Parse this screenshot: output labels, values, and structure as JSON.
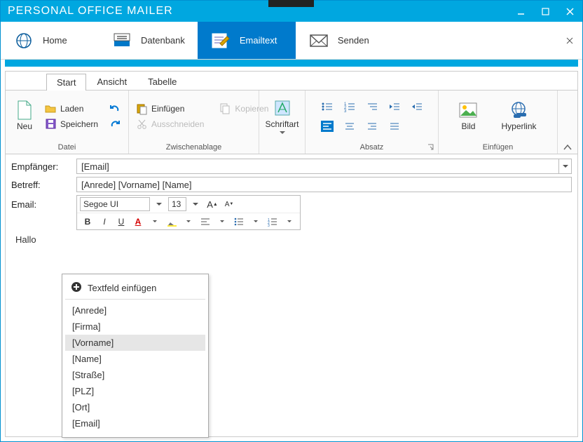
{
  "window": {
    "title": "PERSONAL OFFICE MAILER"
  },
  "nav": {
    "home": "Home",
    "datenbank": "Datenbank",
    "emailtext": "Emailtext",
    "senden": "Senden"
  },
  "tabs": {
    "start": "Start",
    "ansicht": "Ansicht",
    "tabelle": "Tabelle"
  },
  "ribbon": {
    "neu": "Neu",
    "laden": "Laden",
    "speichern": "Speichern",
    "datei": "Datei",
    "einfuegen": "Einfügen",
    "kopieren": "Kopieren",
    "ausschneiden": "Ausschneiden",
    "zwischenablage": "Zwischenablage",
    "schriftart": "Schriftart",
    "absatz": "Absatz",
    "bild": "Bild",
    "hyperlink": "Hyperlink",
    "einfuegen_grp": "Einfügen"
  },
  "fields": {
    "empfaenger_label": "Empfänger:",
    "empfaenger_value": "[Email]",
    "betreff_label": "Betreff:",
    "betreff_value": "[Anrede] [Vorname] [Name]",
    "email_label": "Email:"
  },
  "toolbar": {
    "font_name": "Segoe UI",
    "font_size": "13"
  },
  "editor": {
    "body_text": "Hallo"
  },
  "context": {
    "title": "Textfeld einfügen",
    "items": [
      "[Anrede]",
      "[Firma]",
      "[Vorname]",
      "[Name]",
      "[Straße]",
      "[PLZ]",
      "[Ort]",
      "[Email]"
    ],
    "hover_index": 2
  }
}
